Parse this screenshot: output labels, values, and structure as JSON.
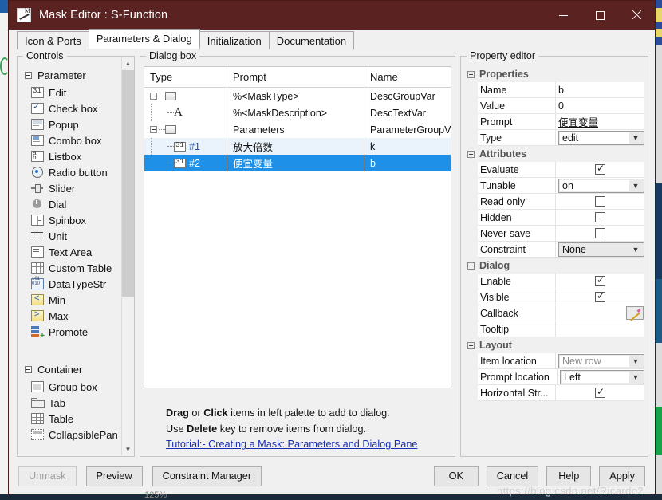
{
  "window": {
    "title": "Mask Editor : S-Function",
    "app_icon": "mask-editor-icon",
    "controls": {
      "minimize": "minimize-icon",
      "maximize": "maximize-icon",
      "close": "close-icon"
    },
    "titlebar_color": "#5b2222"
  },
  "tabs": [
    {
      "label": "Icon & Ports",
      "active": false
    },
    {
      "label": "Parameters & Dialog",
      "active": true
    },
    {
      "label": "Initialization",
      "active": false
    },
    {
      "label": "Documentation",
      "active": false
    }
  ],
  "palette": {
    "group_label": "Controls",
    "sections": [
      {
        "label": "Parameter",
        "items": [
          {
            "label": "Edit",
            "icon": "edit-icon"
          },
          {
            "label": "Check box",
            "icon": "checkbox-icon"
          },
          {
            "label": "Popup",
            "icon": "popup-icon"
          },
          {
            "label": "Combo box",
            "icon": "combobox-icon"
          },
          {
            "label": "Listbox",
            "icon": "listbox-icon"
          },
          {
            "label": "Radio button",
            "icon": "radiobutton-icon"
          },
          {
            "label": "Slider",
            "icon": "slider-icon"
          },
          {
            "label": "Dial",
            "icon": "dial-icon"
          },
          {
            "label": "Spinbox",
            "icon": "spinbox-icon"
          },
          {
            "label": "Unit",
            "icon": "unit-icon"
          },
          {
            "label": "Text Area",
            "icon": "textarea-icon"
          },
          {
            "label": "Custom Table",
            "icon": "customtable-icon"
          },
          {
            "label": "DataTypeStr",
            "icon": "datatypestr-icon"
          },
          {
            "label": "Min",
            "icon": "min-icon"
          },
          {
            "label": "Max",
            "icon": "max-icon"
          },
          {
            "label": "Promote",
            "icon": "promote-icon"
          }
        ]
      },
      {
        "label": "Container",
        "items": [
          {
            "label": "Group box",
            "icon": "groupbox-icon"
          },
          {
            "label": "Tab",
            "icon": "tab-icon"
          },
          {
            "label": "Table",
            "icon": "table-icon"
          },
          {
            "label": "CollapsiblePan",
            "icon": "collapsiblepanel-icon"
          }
        ]
      }
    ]
  },
  "dialog_box": {
    "group_label": "Dialog box",
    "columns": [
      "Type",
      "Prompt",
      "Name"
    ],
    "rows": [
      {
        "indent": 0,
        "icon": "folder-icon",
        "num": "",
        "prompt": "%<MaskType>",
        "name": "DescGroupVar",
        "state": "normal"
      },
      {
        "indent": 1,
        "icon": "text-icon",
        "num": "",
        "prompt": "%<MaskDescription>",
        "name": "DescTextVar",
        "state": "normal"
      },
      {
        "indent": 0,
        "icon": "folder-icon",
        "num": "",
        "prompt": "Parameters",
        "name": "ParameterGroupVar",
        "state": "normal"
      },
      {
        "indent": 1,
        "icon": "edit-icon",
        "num": "#1",
        "prompt": "放大倍数",
        "name": "k",
        "state": "alt"
      },
      {
        "indent": 1,
        "icon": "edit-icon",
        "num": "#2",
        "prompt": "便宜变量",
        "name": "b",
        "state": "selected"
      }
    ],
    "hint": {
      "line1_a": "Drag",
      "line1_b": " or ",
      "line1_c": "Click",
      "line1_d": " items in left palette to add to dialog.",
      "line2_a": "Use ",
      "line2_b": "Delete",
      "line2_c": " key to remove items from dialog.",
      "link": "Tutorial:- Creating a Mask: Parameters and Dialog Pane"
    }
  },
  "property_editor": {
    "group_label": "Property editor",
    "sections": [
      {
        "label": "Properties",
        "rows": [
          {
            "key": "Name",
            "type": "text",
            "value": "b"
          },
          {
            "key": "Value",
            "type": "text",
            "value": "0"
          },
          {
            "key": "Prompt",
            "type": "text-underline",
            "value": "便宜变量"
          },
          {
            "key": "Type",
            "type": "combo",
            "value": "edit",
            "disabled": false
          }
        ]
      },
      {
        "label": "Attributes",
        "rows": [
          {
            "key": "Evaluate",
            "type": "checkbox",
            "checked": true
          },
          {
            "key": "Tunable",
            "type": "combo",
            "value": "on",
            "disabled": false
          },
          {
            "key": "Read only",
            "type": "checkbox",
            "checked": false
          },
          {
            "key": "Hidden",
            "type": "checkbox",
            "checked": false
          },
          {
            "key": "Never save",
            "type": "checkbox",
            "checked": false
          },
          {
            "key": "Constraint",
            "type": "combo-flat",
            "value": "None",
            "disabled": false
          }
        ]
      },
      {
        "label": "Dialog",
        "rows": [
          {
            "key": "Enable",
            "type": "checkbox",
            "checked": true
          },
          {
            "key": "Visible",
            "type": "checkbox",
            "checked": true
          },
          {
            "key": "Callback",
            "type": "pencil",
            "value": ""
          },
          {
            "key": "Tooltip",
            "type": "text",
            "value": ""
          }
        ]
      },
      {
        "label": "Layout",
        "rows": [
          {
            "key": "Item location",
            "type": "combo",
            "value": "New row",
            "disabled": true
          },
          {
            "key": "Prompt location",
            "type": "combo",
            "value": "Left",
            "disabled": false
          },
          {
            "key": "Horizontal Str...",
            "type": "checkbox",
            "checked": true
          }
        ]
      }
    ]
  },
  "buttons": {
    "unmask": "Unmask",
    "preview": "Preview",
    "constraint_manager": "Constraint Manager",
    "ok": "OK",
    "cancel": "Cancel",
    "help": "Help",
    "apply": "Apply"
  },
  "background": {
    "watermark": "https://blog.csdn.net/Ricardo2",
    "zoom_label": "125%"
  }
}
